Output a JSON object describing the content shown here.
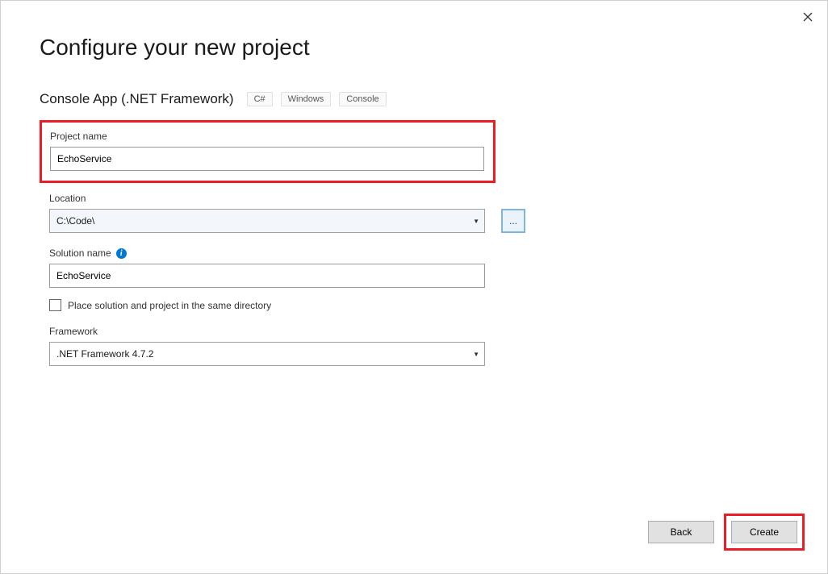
{
  "window": {
    "title": "Configure your new project"
  },
  "template": {
    "name": "Console App (.NET Framework)",
    "tags": [
      "C#",
      "Windows",
      "Console"
    ]
  },
  "fields": {
    "projectName": {
      "label": "Project name",
      "value": "EchoService"
    },
    "location": {
      "label": "Location",
      "value": "C:\\Code\\",
      "browse": "..."
    },
    "solutionName": {
      "label": "Solution name",
      "value": "EchoService"
    },
    "sameDirectory": {
      "label": "Place solution and project in the same directory"
    },
    "framework": {
      "label": "Framework",
      "value": ".NET Framework 4.7.2"
    }
  },
  "buttons": {
    "back": "Back",
    "create": "Create"
  }
}
